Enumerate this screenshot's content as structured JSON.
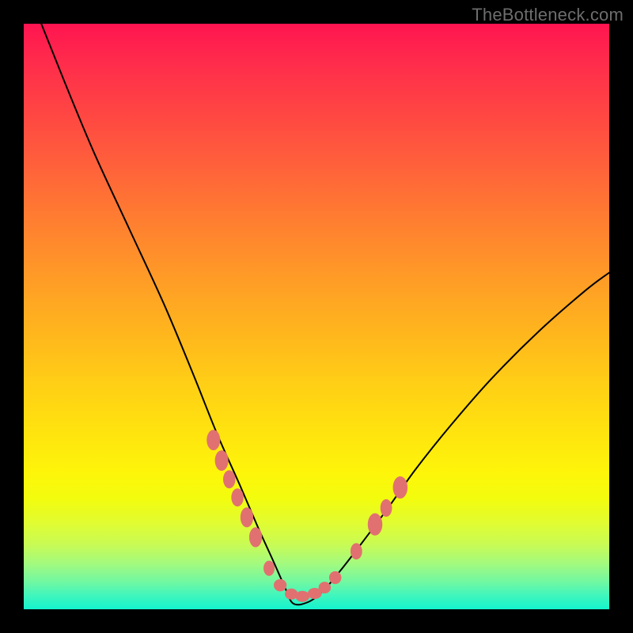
{
  "watermark": "TheBottleneck.com",
  "colors": {
    "curve": "#000000",
    "dots": "#e17170",
    "gradient_top": "#ff1450",
    "gradient_bottom": "#14f3cf"
  },
  "chart_data": {
    "type": "line",
    "title": "",
    "xlabel": "",
    "ylabel": "",
    "xlim": [
      0,
      100
    ],
    "ylim": [
      0,
      100
    ],
    "grid": false,
    "legend": false,
    "comment": "Axes have no tick labels or numeric scale in the image; x and y are expressed as percent of plot width/height with (0,0) at bottom-left. V-shaped curve; minimum ~(46,0). Left branch is steeper than the right branch.",
    "series": [
      {
        "name": "curve",
        "x": [
          0,
          3,
          7,
          12,
          18,
          24,
          29,
          33,
          37,
          40,
          42.5,
          44.5,
          46,
          48.5,
          51,
          54,
          57.5,
          62,
          67,
          73,
          80,
          88,
          96,
          100
        ],
        "y": [
          108,
          100,
          90,
          78,
          65,
          52,
          40,
          30,
          21,
          14,
          8.5,
          4,
          1,
          1.2,
          3,
          6.5,
          11,
          17,
          24,
          31.5,
          39.5,
          47.5,
          54.5,
          57.5
        ]
      }
    ],
    "dots": {
      "comment": "Highlighted points along the lower region of the curve (centers, in the same percent coordinate space as the series). rx/ry give the approximate extent of each elongated dot as percent of plot size.",
      "left_branch": [
        {
          "x": 32.4,
          "y": 28.9,
          "rx": 1.15,
          "ry": 1.75
        },
        {
          "x": 33.8,
          "y": 25.4,
          "rx": 1.15,
          "ry": 1.75
        },
        {
          "x": 35.1,
          "y": 22.2,
          "rx": 1.05,
          "ry": 1.55
        },
        {
          "x": 36.5,
          "y": 19.1,
          "rx": 1.05,
          "ry": 1.55
        },
        {
          "x": 38.1,
          "y": 15.7,
          "rx": 1.1,
          "ry": 1.7
        },
        {
          "x": 39.6,
          "y": 12.3,
          "rx": 1.1,
          "ry": 1.7
        }
      ],
      "trough": [
        {
          "x": 41.9,
          "y": 7.0,
          "rx": 0.95,
          "ry": 1.3
        },
        {
          "x": 43.8,
          "y": 4.1,
          "rx": 1.1,
          "ry": 1.05
        },
        {
          "x": 45.7,
          "y": 2.6,
          "rx": 1.1,
          "ry": 0.95
        },
        {
          "x": 47.6,
          "y": 2.2,
          "rx": 1.2,
          "ry": 0.95
        },
        {
          "x": 49.7,
          "y": 2.7,
          "rx": 1.2,
          "ry": 0.95
        },
        {
          "x": 51.4,
          "y": 3.7,
          "rx": 1.05,
          "ry": 1.0
        },
        {
          "x": 53.2,
          "y": 5.4,
          "rx": 1.05,
          "ry": 1.1
        }
      ],
      "right_branch": [
        {
          "x": 56.8,
          "y": 9.9,
          "rx": 1.0,
          "ry": 1.4
        },
        {
          "x": 60.0,
          "y": 14.5,
          "rx": 1.25,
          "ry": 1.9
        },
        {
          "x": 61.9,
          "y": 17.3,
          "rx": 1.0,
          "ry": 1.5
        },
        {
          "x": 64.3,
          "y": 20.8,
          "rx": 1.25,
          "ry": 1.9
        }
      ]
    }
  }
}
